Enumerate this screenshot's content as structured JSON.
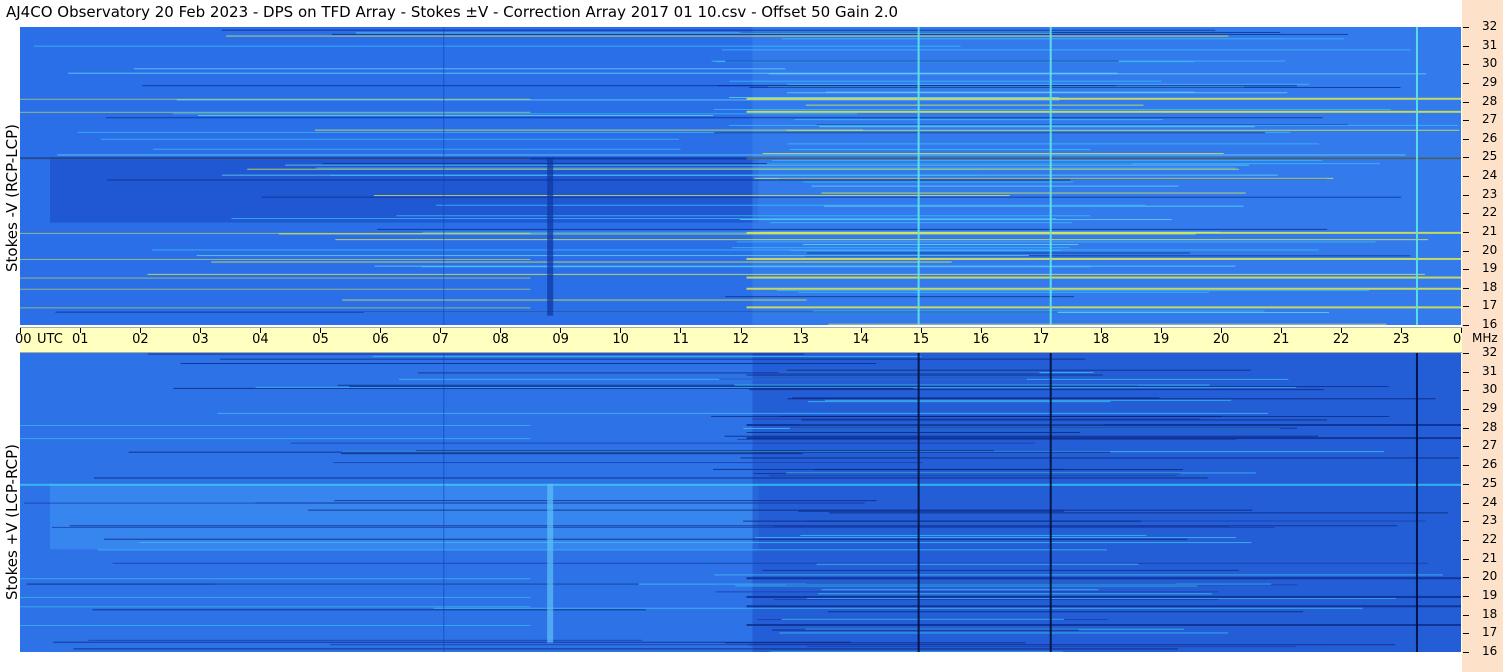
{
  "title": "AJ4CO Observatory  20 Feb 2023  -  DPS on TFD Array  -  Stokes ±V  -  Correction Array 2017 01 10.csv  -  Offset 50  Gain 2.0",
  "colors": {
    "background_blue": "#2a6ee8",
    "dark_blue": "#0a2a8a",
    "cyan": "#3ad6f0",
    "yellow": "#e8f040",
    "time_bar": "#ffffc0",
    "freq_column": "#fde2c9"
  },
  "chart_data": [
    {
      "type": "heatmap",
      "ylabel": "Stokes -V  (RCP-LCP)",
      "x_ticks": [
        "00",
        "01",
        "02",
        "03",
        "04",
        "05",
        "06",
        "07",
        "08",
        "09",
        "10",
        "11",
        "12",
        "13",
        "14",
        "15",
        "16",
        "17",
        "18",
        "19",
        "20",
        "21",
        "22",
        "23",
        "00"
      ],
      "x_unit": "UTC",
      "y_ticks": [
        32,
        31,
        30,
        29,
        28,
        27,
        26,
        25,
        24,
        23,
        22,
        21,
        20,
        19,
        18,
        17,
        16
      ],
      "y_unit": "MHz",
      "ylim": [
        16,
        32
      ],
      "bright_rows_mhz": [
        28.2,
        27.5,
        25.0,
        21.0,
        19.6,
        18.6,
        18.0,
        17.0
      ],
      "vertical_lines_utc": [
        14.95,
        17.15,
        23.25
      ]
    },
    {
      "type": "heatmap",
      "ylabel": "Stokes +V  (LCP-RCP)",
      "x_ticks": [
        "00",
        "01",
        "02",
        "03",
        "04",
        "05",
        "06",
        "07",
        "08",
        "09",
        "10",
        "11",
        "12",
        "13",
        "14",
        "15",
        "16",
        "17",
        "18",
        "19",
        "20",
        "21",
        "22",
        "23",
        "00"
      ],
      "x_unit": "UTC",
      "y_ticks": [
        32,
        31,
        30,
        29,
        28,
        27,
        26,
        25,
        24,
        23,
        22,
        21,
        20,
        19,
        18,
        17,
        16
      ],
      "y_unit": "MHz",
      "ylim": [
        16,
        32
      ],
      "dark_rows_mhz": [
        28.2,
        27.5,
        20.0,
        19.0,
        18.5,
        17.5
      ],
      "vertical_lines_utc": [
        14.95,
        17.15,
        23.25
      ]
    }
  ],
  "time_axis": {
    "first_label": "00",
    "utc_label": "UTC",
    "labels": [
      "01",
      "02",
      "03",
      "04",
      "05",
      "06",
      "07",
      "08",
      "09",
      "10",
      "11",
      "12",
      "13",
      "14",
      "15",
      "16",
      "17",
      "18",
      "19",
      "20",
      "21",
      "22",
      "23",
      "00"
    ]
  },
  "freq_axis": {
    "unit": "MHz",
    "labels": [
      "32",
      "31",
      "30",
      "29",
      "28",
      "27",
      "26",
      "25",
      "24",
      "23",
      "22",
      "21",
      "20",
      "19",
      "18",
      "17",
      "16"
    ]
  }
}
